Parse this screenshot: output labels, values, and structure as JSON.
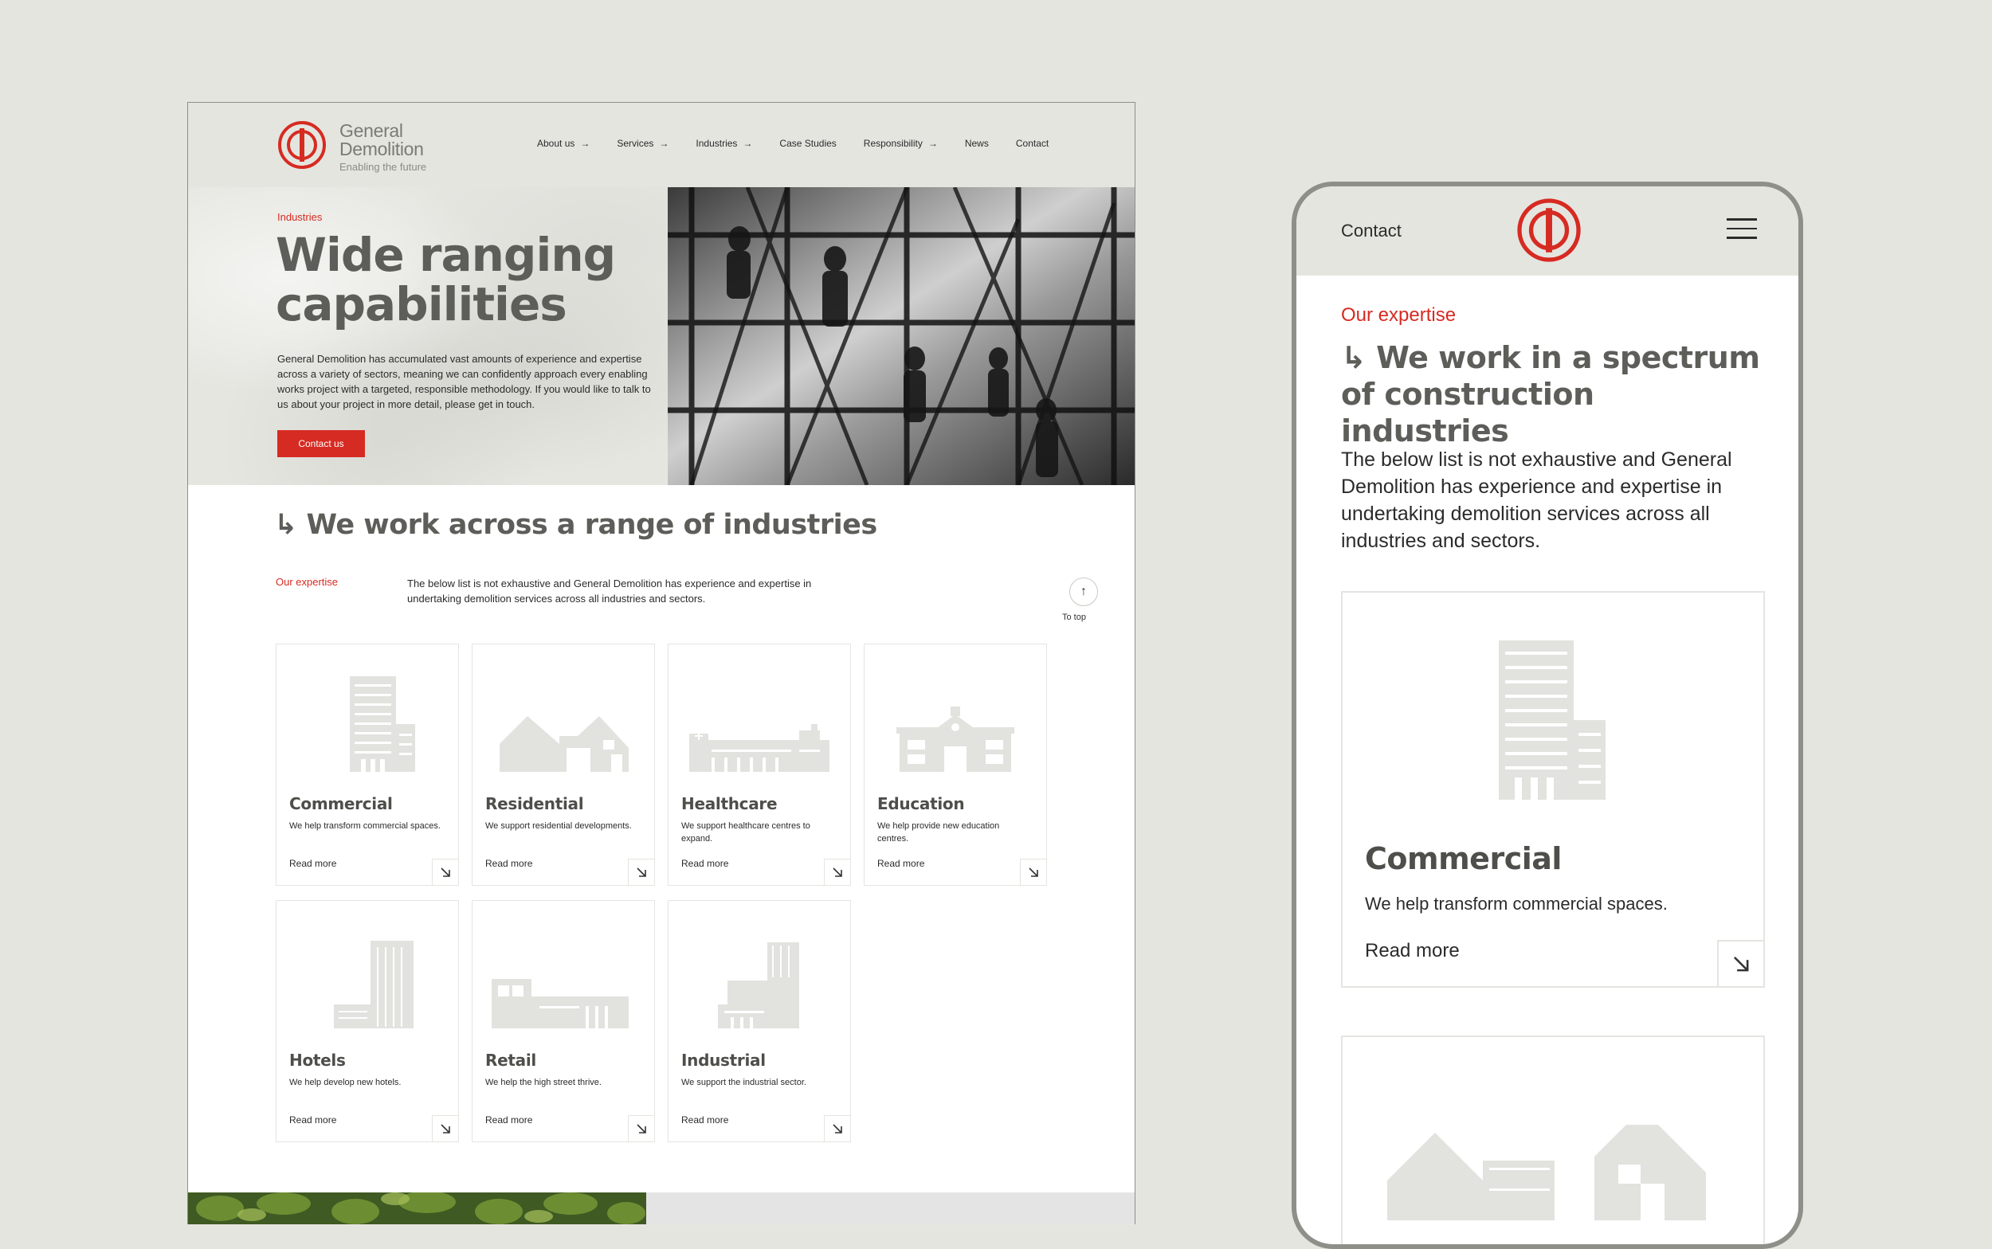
{
  "desktop": {
    "logo": {
      "line1": "General",
      "line2": "Demolition",
      "tagline": "Enabling the future"
    },
    "nav": [
      {
        "label": "About us",
        "arrow": true
      },
      {
        "label": "Services",
        "arrow": true
      },
      {
        "label": "Industries",
        "arrow": true
      },
      {
        "label": "Case Studies",
        "arrow": false
      },
      {
        "label": "Responsibility",
        "arrow": true
      },
      {
        "label": "News",
        "arrow": false
      },
      {
        "label": "Contact",
        "arrow": false
      }
    ],
    "hero": {
      "kicker": "Industries",
      "title": "Wide ranging capabilities",
      "body": "General Demolition has accumulated vast amounts of experience and expertise across a variety of sectors, meaning we can confidently approach every enabling works project with a targeted, responsible methodology. If you would like to talk to us about your project in more detail, please get in touch.",
      "button": "Contact us"
    },
    "section": {
      "title": "↳ We work across a range of industries",
      "kicker": "Our expertise",
      "body": "The below list is not exhaustive and General Demolition has experience and expertise in undertaking demolition services across all industries and sectors.",
      "to_top": "To top"
    },
    "cards": [
      {
        "title": "Commercial",
        "desc": "We help transform commercial spaces.",
        "more": "Read more",
        "icon": "office-tower-icon"
      },
      {
        "title": "Residential",
        "desc": "We support residential developments.",
        "more": "Read more",
        "icon": "houses-icon"
      },
      {
        "title": "Healthcare",
        "desc": "We support healthcare centres to expand.",
        "more": "Read more",
        "icon": "hospital-icon"
      },
      {
        "title": "Education",
        "desc": "We help provide new education centres.",
        "more": "Read more",
        "icon": "school-icon"
      },
      {
        "title": "Hotels",
        "desc": "We help develop new hotels.",
        "more": "Read more",
        "icon": "hotel-icon"
      },
      {
        "title": "Retail",
        "desc": "We help the high street thrive.",
        "more": "Read more",
        "icon": "shop-icon"
      },
      {
        "title": "Industrial",
        "desc": "We support the industrial sector.",
        "more": "Read more",
        "icon": "factory-icon"
      }
    ]
  },
  "mobile": {
    "contact": "Contact",
    "kicker": "Our expertise",
    "title": "↳ We work in a spectrum of construction industries",
    "body": "The below list is not exhaustive and General Demolition has experience and expertise in undertaking demolition services across all industries and sectors.",
    "card": {
      "title": "Commercial",
      "desc": "We help transform commercial spaces.",
      "more": "Read more"
    }
  },
  "colors": {
    "accent": "#d62b22",
    "background": "#e5e5e0",
    "heading": "#5d5d59",
    "illustration": "#e2e2de"
  }
}
